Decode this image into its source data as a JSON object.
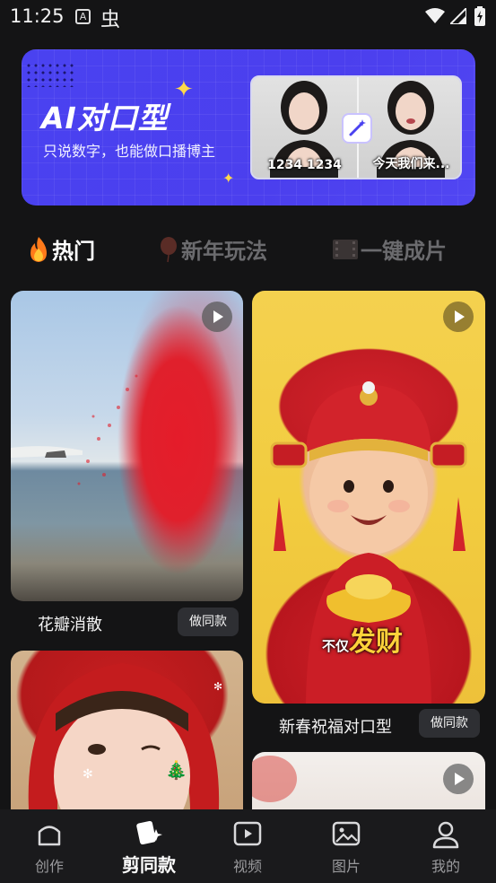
{
  "status_bar": {
    "time": "11:25",
    "icon_a_glyph": "A",
    "icon_b_glyph": "虫"
  },
  "banner": {
    "title": "AI对口型",
    "subtitle": "只说数字，也能做口播博主",
    "left_caption": "1234  1234",
    "right_caption": "今天我们来..."
  },
  "tabs": [
    {
      "label": "热门",
      "icon": "fire-icon",
      "active": true
    },
    {
      "label": "新年玩法",
      "icon": "balloon-icon",
      "active": false
    },
    {
      "label": "一键成片",
      "icon": "film-icon",
      "active": false
    }
  ],
  "cards": [
    {
      "title": "花瓣消散",
      "action": "做同款"
    },
    {
      "title": "新春祝福对口型",
      "action": "做同款",
      "overlay_small": "不仅",
      "overlay_big": "发财"
    }
  ],
  "bottom_nav": [
    {
      "label": "创作",
      "icon": "home-icon",
      "active": false
    },
    {
      "label": "剪同款",
      "icon": "template-icon",
      "active": true
    },
    {
      "label": "视频",
      "icon": "video-icon",
      "active": false
    },
    {
      "label": "图片",
      "icon": "image-icon",
      "active": false
    },
    {
      "label": "我的",
      "icon": "profile-icon",
      "active": false
    }
  ],
  "colors": {
    "background": "#141415",
    "banner": "#4a42f0",
    "accent_gold": "#ffd84a",
    "inactive_text": "#6b6b6e"
  }
}
